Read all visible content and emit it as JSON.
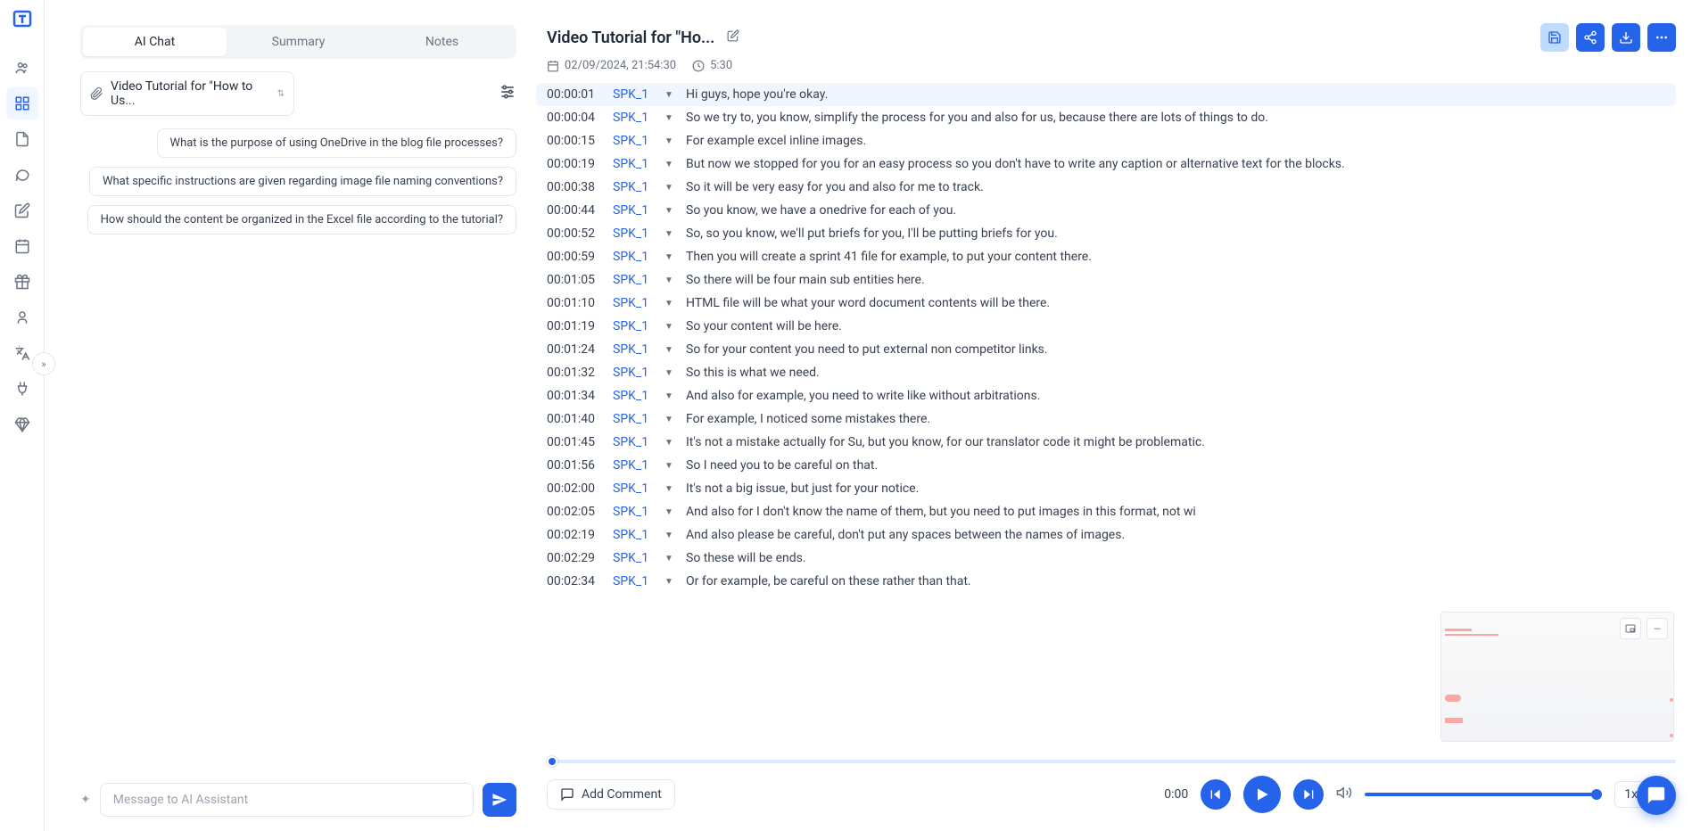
{
  "tabs": [
    {
      "label": "AI Chat",
      "active": true
    },
    {
      "label": "Summary",
      "active": false
    },
    {
      "label": "Notes",
      "active": false
    }
  ],
  "file_selected": "Video Tutorial for \"How to Us...",
  "suggestions": [
    "What is the purpose of using OneDrive in the blog file processes?",
    "What specific instructions are given regarding image file naming conventions?",
    "How should the content be organized in the Excel file according to the tutorial?"
  ],
  "chat_placeholder": "Message to AI Assistant",
  "title": "Video Tutorial for \"Ho...",
  "date": "02/09/2024, 21:54:30",
  "duration": "5:30",
  "transcript": [
    {
      "ts": "00:00:01",
      "spk": "SPK_1",
      "text": "Hi guys, hope you're okay.",
      "highlight": true
    },
    {
      "ts": "00:00:04",
      "spk": "SPK_1",
      "text": "So we try to, you know, simplify the process for you and also for us, because there are lots of things to do."
    },
    {
      "ts": "00:00:15",
      "spk": "SPK_1",
      "text": "For example excel inline images."
    },
    {
      "ts": "00:00:19",
      "spk": "SPK_1",
      "text": "But now we stopped for you for an easy process so you don't have to write any caption or alternative text for the blocks."
    },
    {
      "ts": "00:00:38",
      "spk": "SPK_1",
      "text": "So it will be very easy for you and also for me to track."
    },
    {
      "ts": "00:00:44",
      "spk": "SPK_1",
      "text": "So you know, we have a onedrive for each of you."
    },
    {
      "ts": "00:00:52",
      "spk": "SPK_1",
      "text": "So, so you know, we'll put briefs for you, I'll be putting briefs for you."
    },
    {
      "ts": "00:00:59",
      "spk": "SPK_1",
      "text": "Then you will create a sprint 41 file for example, to put your content there."
    },
    {
      "ts": "00:01:05",
      "spk": "SPK_1",
      "text": "So there will be four main sub entities here."
    },
    {
      "ts": "00:01:10",
      "spk": "SPK_1",
      "text": "HTML file will be what your word document contents will be there."
    },
    {
      "ts": "00:01:19",
      "spk": "SPK_1",
      "text": "So your content will be here."
    },
    {
      "ts": "00:01:24",
      "spk": "SPK_1",
      "text": "So for your content you need to put external non competitor links."
    },
    {
      "ts": "00:01:32",
      "spk": "SPK_1",
      "text": "So this is what we need."
    },
    {
      "ts": "00:01:34",
      "spk": "SPK_1",
      "text": "And also for example, you need to write like without arbitrations."
    },
    {
      "ts": "00:01:40",
      "spk": "SPK_1",
      "text": "For example, I noticed some mistakes there."
    },
    {
      "ts": "00:01:45",
      "spk": "SPK_1",
      "text": "It's not a mistake actually for Su, but you know, for our translator code it might be problematic."
    },
    {
      "ts": "00:01:56",
      "spk": "SPK_1",
      "text": "So I need you to be careful on that."
    },
    {
      "ts": "00:02:00",
      "spk": "SPK_1",
      "text": "It's not a big issue, but just for your notice."
    },
    {
      "ts": "00:02:05",
      "spk": "SPK_1",
      "text": "And also for I don't know the name of them, but you need to put images in this format, not wi"
    },
    {
      "ts": "00:02:19",
      "spk": "SPK_1",
      "text": "And also please be careful, don't put any spaces between the names of images."
    },
    {
      "ts": "00:02:29",
      "spk": "SPK_1",
      "text": "So these will be ends."
    },
    {
      "ts": "00:02:34",
      "spk": "SPK_1",
      "text": "Or for example, be careful on these rather than that."
    }
  ],
  "player": {
    "comment_label": "Add Comment",
    "current_time": "0:00",
    "speed": "1x"
  }
}
